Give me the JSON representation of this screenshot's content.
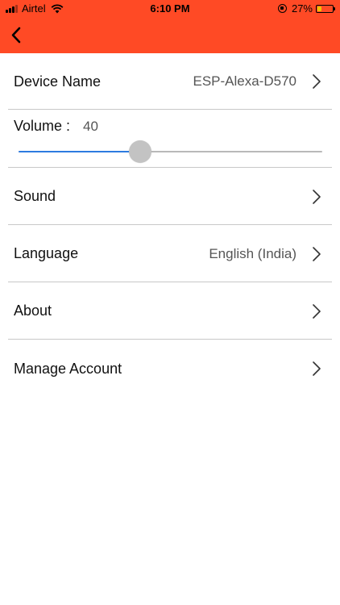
{
  "status_bar": {
    "carrier": "Airtel",
    "time": "6:10 PM",
    "battery": "27%",
    "battery_level": 0.27,
    "battery_color": "#f2c200"
  },
  "header": {
    "background": "#ff4a25",
    "back_icon": "chevron-left-icon"
  },
  "settings": {
    "device_name": {
      "label": "Device Name",
      "value": "ESP-Alexa-D570"
    },
    "volume": {
      "label": "Volume :",
      "value": "40",
      "level_percent": 40,
      "accent": "#2d7be0"
    },
    "sound": {
      "label": "Sound"
    },
    "language": {
      "label": "Language",
      "value": "English (India)"
    },
    "about": {
      "label": "About"
    },
    "manage_account": {
      "label": "Manage Account"
    }
  }
}
